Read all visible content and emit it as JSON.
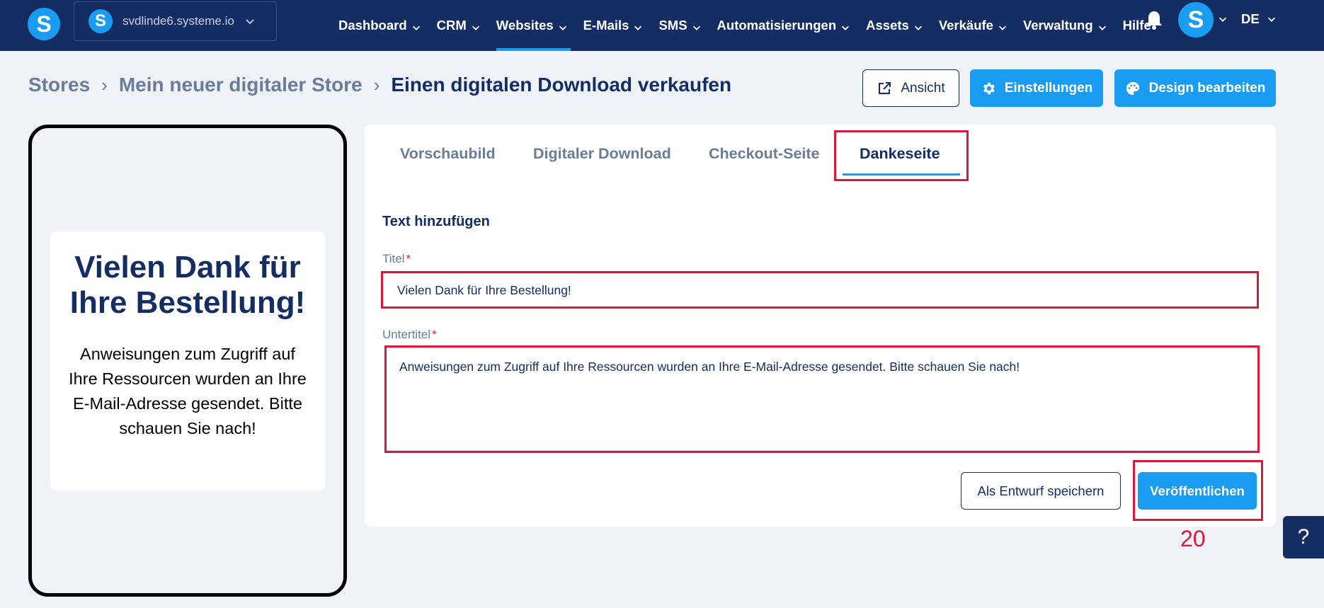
{
  "topnav": {
    "logo_letter": "S",
    "domain_logo_letter": "S",
    "domain": "svdlinde6.systeme.io",
    "items": [
      {
        "label": "Dashboard"
      },
      {
        "label": "CRM"
      },
      {
        "label": "Websites"
      },
      {
        "label": "E-Mails"
      },
      {
        "label": "SMS"
      },
      {
        "label": "Automatisierungen"
      },
      {
        "label": "Assets"
      },
      {
        "label": "Verkäufe"
      },
      {
        "label": "Verwaltung"
      },
      {
        "label": "Hilfe"
      }
    ],
    "active_item": "Websites",
    "avatar_letter": "S",
    "language": "DE"
  },
  "breadcrumb": {
    "items": [
      "Stores",
      "Mein neuer digitaler Store"
    ],
    "current": "Einen digitalen Download verkaufen"
  },
  "header_buttons": {
    "view": "Ansicht",
    "settings": "Einstellungen",
    "design": "Design bearbeiten"
  },
  "preview": {
    "title": "Vielen Dank für Ihre Bestellung!",
    "subtitle": "Anweisungen zum Zugriff auf Ihre Ressourcen wurden an Ihre E-Mail-Adresse gesendet. Bitte schauen Sie nach!"
  },
  "tabs": [
    {
      "label": "Vorschaubild"
    },
    {
      "label": "Digitaler Download"
    },
    {
      "label": "Checkout-Seite"
    },
    {
      "label": "Dankeseite"
    }
  ],
  "active_tab": "Dankeseite",
  "form": {
    "section_title": "Text hinzufügen",
    "title_label": "Titel",
    "title_value": "Vielen Dank für Ihre Bestellung!",
    "subtitle_label": "Untertitel",
    "subtitle_value": "Anweisungen zum Zugriff auf Ihre Ressourcen wurden an Ihre E-Mail-Adresse gesendet. Bitte schauen Sie nach!",
    "required_mark": "*",
    "draft_button": "Als Entwurf speichern",
    "publish_button": "Veröffentlichen"
  },
  "annotation": {
    "step_number": "20"
  },
  "help": {
    "label": "?"
  },
  "colors": {
    "nav_bg": "#142d63",
    "accent": "#1a9cf2",
    "highlight": "#d7193d"
  }
}
